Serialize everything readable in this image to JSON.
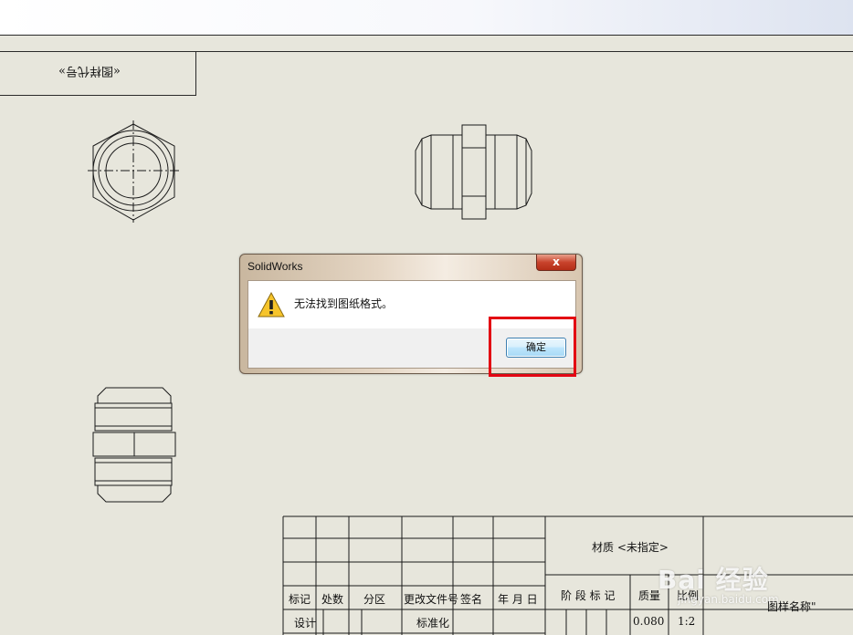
{
  "drawing": {
    "code_label": "«图样代号»"
  },
  "dialog": {
    "title": "SolidWorks",
    "close_glyph": "x",
    "message": "无法找到图纸格式。",
    "ok_label": "确定",
    "icon": "warning-icon"
  },
  "title_block": {
    "material": "材质 <未指定>",
    "stage_mark": "阶 段 标 记",
    "mass_header": "质量",
    "scale_header": "比例",
    "mass_value": "0.080",
    "scale_value": "1:2",
    "drawing_name": "图样名称\"",
    "headers": [
      "标记",
      "处数",
      "分区",
      "更改文件号",
      "签名",
      "年 月 日"
    ],
    "row_labels": {
      "design": "设计",
      "standard": "标准化"
    }
  },
  "watermark": {
    "main": "Bai 经验",
    "sub": "jingyan.baidu.com"
  },
  "colors": {
    "highlight": "#e30613",
    "sheet": "#e7e6dc"
  }
}
